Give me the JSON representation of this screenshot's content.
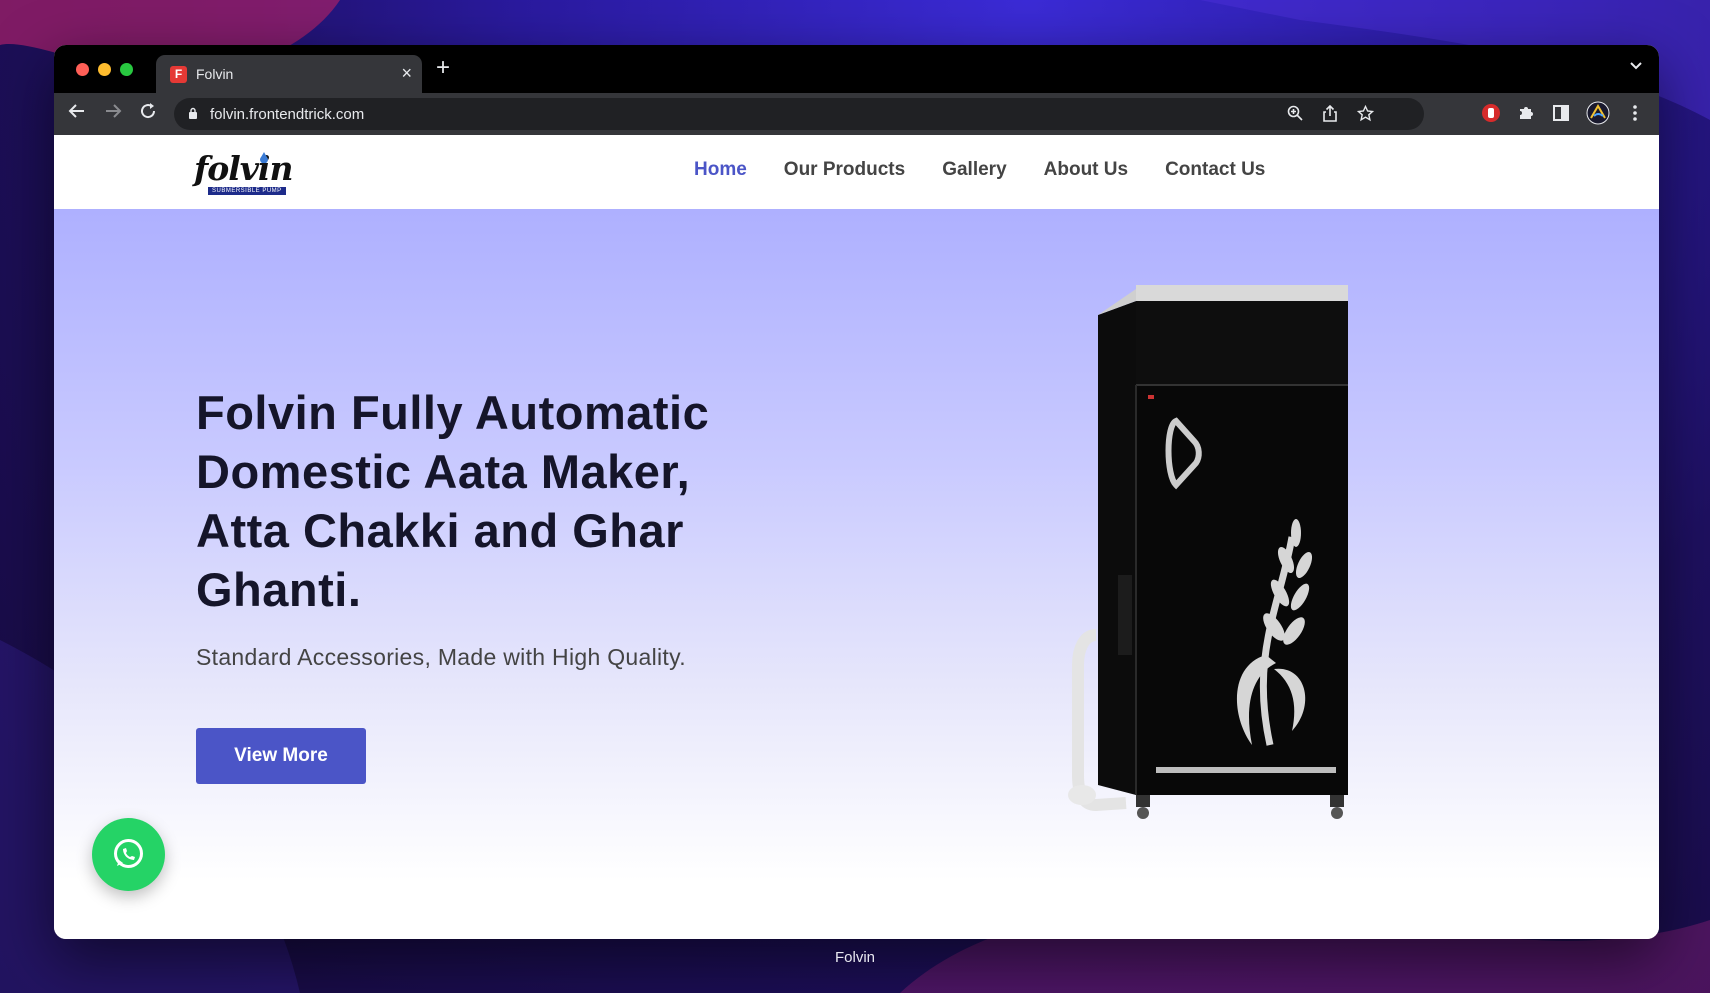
{
  "browser": {
    "tab_title": "Folvin",
    "tab_favicon_letter": "F",
    "url": "folvin.frontendtrick.com",
    "icons": {
      "back": "arrow-left-icon",
      "forward": "arrow-right-icon",
      "reload": "reload-icon",
      "lock": "lock-icon",
      "zoom": "zoom-icon",
      "share": "share-icon",
      "bookmark": "star-icon",
      "extensions": "puzzle-icon",
      "side_panel": "side-panel-icon",
      "menu": "kebab-menu-icon"
    }
  },
  "site": {
    "logo_text": "folvin",
    "logo_subtext": "SUBMERSIBLE PUMP",
    "nav": [
      {
        "label": "Home",
        "active": true
      },
      {
        "label": "Our Products",
        "active": false
      },
      {
        "label": "Gallery",
        "active": false
      },
      {
        "label": "About Us",
        "active": false
      },
      {
        "label": "Contact Us",
        "active": false
      }
    ],
    "hero": {
      "title": "Folvin Fully Automatic Domestic Aata Maker, Atta Chakki and Ghar Ghanti.",
      "subtitle": "Standard Accessories, Made with High Quality.",
      "button_label": "View More"
    }
  },
  "window_caption": "Folvin",
  "colors": {
    "accent": "#4b55c7",
    "hero_top": "#aeb0ff",
    "whatsapp": "#25d366"
  }
}
